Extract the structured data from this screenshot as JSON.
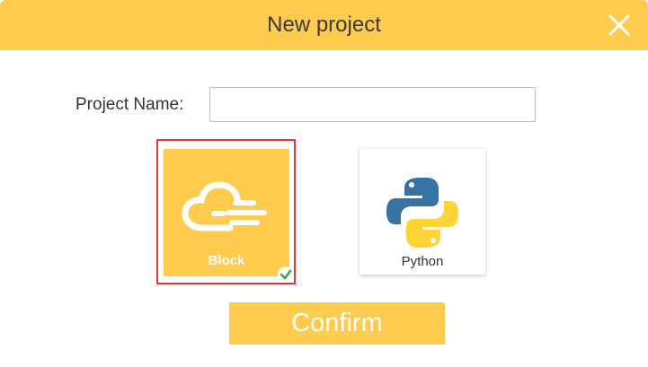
{
  "dialog": {
    "title": "New project",
    "close_icon": "close-icon"
  },
  "form": {
    "name_label": "Project Name:",
    "name_value": "",
    "name_placeholder": ""
  },
  "project_types": [
    {
      "label": "Block",
      "icon": "cloud-icon",
      "selected": true
    },
    {
      "label": "Python",
      "icon": "python-logo-icon",
      "selected": false
    }
  ],
  "actions": {
    "confirm_label": "Confirm"
  },
  "colors": {
    "accent": "#fecb4e",
    "selection_border": "#e53935",
    "check": "#43a047"
  }
}
